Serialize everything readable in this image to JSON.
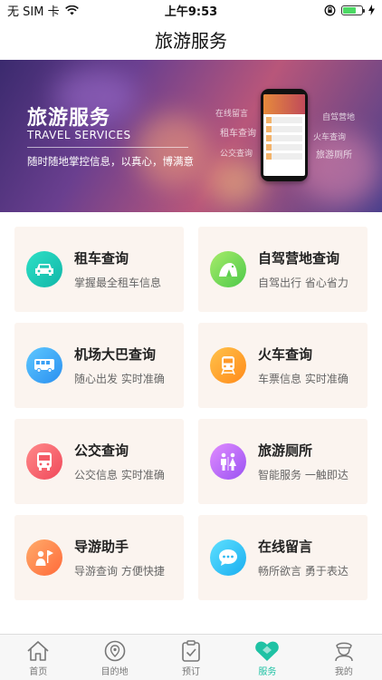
{
  "status_bar": {
    "carrier": "无 SIM 卡",
    "time": "上午9:53",
    "battery_level": 0.7
  },
  "nav": {
    "title": "旅游服务"
  },
  "banner": {
    "title": "旅游服务",
    "subtitle": "TRAVEL SERVICES",
    "description": "随时随地掌控信息，以真心，博满意",
    "tags": [
      "在线留言",
      "租车查询",
      "公交查询",
      "自驾营地",
      "火车查询",
      "旅游厕所"
    ]
  },
  "services": [
    {
      "title": "租车查询",
      "subtitle": "掌握最全租车信息",
      "icon": "car-icon",
      "color_from": "#2ee0c6",
      "color_to": "#10b6a8"
    },
    {
      "title": "自驾营地查询",
      "subtitle": "自驾出行 省心省力",
      "icon": "tent-icon",
      "color_from": "#a8ec6a",
      "color_to": "#4cc94a"
    },
    {
      "title": "机场大巴查询",
      "subtitle": "随心出发 实时准确",
      "icon": "bus-icon",
      "color_from": "#5ec8ff",
      "color_to": "#2a8ff0"
    },
    {
      "title": "火车查询",
      "subtitle": "车票信息 实时准确",
      "icon": "train-icon",
      "color_from": "#ffc24a",
      "color_to": "#ff8a1a"
    },
    {
      "title": "公交查询",
      "subtitle": "公交信息 实时准确",
      "icon": "city-bus-icon",
      "color_from": "#ff8a8a",
      "color_to": "#f0485a"
    },
    {
      "title": "旅游厕所",
      "subtitle": "智能服务 一触即达",
      "icon": "restroom-icon",
      "color_from": "#e08cff",
      "color_to": "#9a52f2"
    },
    {
      "title": "导游助手",
      "subtitle": "导游查询 方便快捷",
      "icon": "guide-icon",
      "color_from": "#ffab6a",
      "color_to": "#ff6a3a"
    },
    {
      "title": "在线留言",
      "subtitle": "畅所欲言 勇于表达",
      "icon": "chat-icon",
      "color_from": "#5ee0ff",
      "color_to": "#1aaef0"
    }
  ],
  "tabbar": {
    "active_color": "#1fc2a4",
    "tabs": [
      {
        "label": "首页",
        "icon": "home-icon"
      },
      {
        "label": "目的地",
        "icon": "destination-icon"
      },
      {
        "label": "预订",
        "icon": "booking-icon"
      },
      {
        "label": "服务",
        "icon": "service-heart-icon"
      },
      {
        "label": "我的",
        "icon": "profile-icon"
      }
    ]
  }
}
